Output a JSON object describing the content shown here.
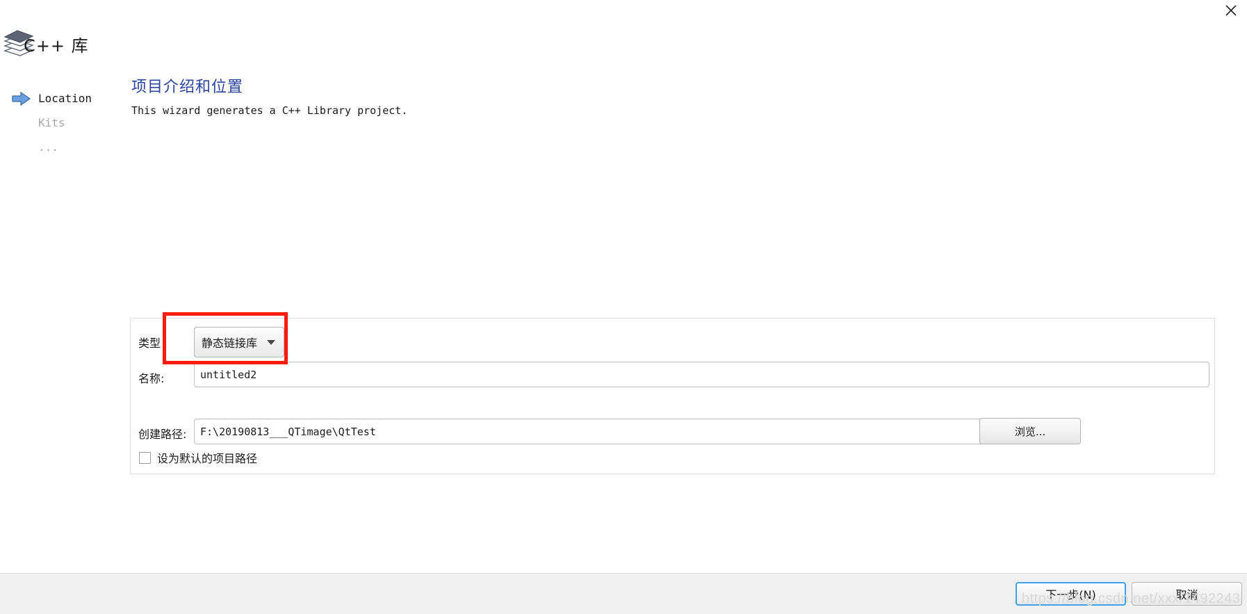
{
  "window": {
    "close_label": "✕",
    "wizard_title": "C++ 库"
  },
  "nav": {
    "items": [
      {
        "label": "Location",
        "state": "active"
      },
      {
        "label": "Kits",
        "state": "inactive"
      },
      {
        "label": "...",
        "state": "inactive"
      }
    ]
  },
  "content": {
    "title": "项目介绍和位置",
    "description": "This wizard generates a C++ Library project."
  },
  "form": {
    "type_label": "类型",
    "type_value": "静态链接库",
    "name_label": "名称:",
    "name_value": "untitled2",
    "path_label": "创建路径:",
    "path_value": "F:\\20190813___QTimage\\QtTest",
    "browse_label": "浏览...",
    "default_path_checkbox_label": "设为默认的项目路径",
    "default_path_checked": false
  },
  "footer": {
    "next_label": "下一步(N)",
    "next_mnemonic": "N",
    "cancel_label": "取消"
  },
  "annotation": {
    "color": "#fb1b08",
    "target": "类型"
  },
  "watermark": {
    "text": "https://blog.csdn.net/xxx/1492243"
  }
}
